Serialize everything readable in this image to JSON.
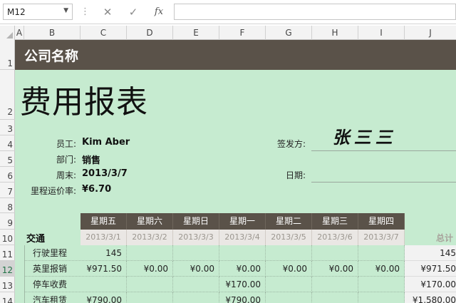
{
  "formula_bar": {
    "name_box": "M12",
    "cancel_icon": "✕",
    "enter_icon": "✓",
    "fx_label": "fx",
    "formula": ""
  },
  "columns": [
    "A",
    "B",
    "C",
    "D",
    "E",
    "F",
    "G",
    "H",
    "I",
    "J"
  ],
  "rows": [
    "1",
    "2",
    "3",
    "4",
    "5",
    "6",
    "7",
    "8",
    "9",
    "10",
    "11",
    "12",
    "13",
    "14"
  ],
  "selected_row": "12",
  "sheet": {
    "company": "公司名称",
    "title": "费用报表",
    "employee_label": "员工:",
    "employee": "Kim Aber",
    "dept_label": "部门:",
    "dept": "销售",
    "week_label": "周末:",
    "week": "2013/3/7",
    "rate_label": "里程运价率:",
    "rate": "¥6.70",
    "approver_label": "签发方:",
    "approver_signature": "张三三",
    "date_label": "日期:"
  },
  "table": {
    "section": "交通",
    "total_label": "总计",
    "days": [
      "星期五",
      "星期六",
      "星期日",
      "星期一",
      "星期二",
      "星期三",
      "星期四"
    ],
    "dates": [
      "2013/3/1",
      "2013/3/2",
      "2013/3/3",
      "2013/3/4",
      "2013/3/5",
      "2013/3/6",
      "2013/3/7"
    ],
    "rows": [
      {
        "label": "行驶里程",
        "values": [
          "145",
          "",
          "",
          "",
          "",
          "",
          ""
        ],
        "total": "145"
      },
      {
        "label": "英里报销",
        "values": [
          "¥971.50",
          "¥0.00",
          "¥0.00",
          "¥0.00",
          "¥0.00",
          "¥0.00",
          "¥0.00"
        ],
        "total": "¥971.50"
      },
      {
        "label": "停车收费",
        "values": [
          "",
          "",
          "",
          "¥170.00",
          "",
          "",
          ""
        ],
        "total": "¥170.00"
      },
      {
        "label": "汽车租赁",
        "values": [
          "¥790.00",
          "",
          "",
          "¥790.00",
          "",
          "",
          ""
        ],
        "total": "¥1,580.00"
      }
    ]
  }
}
